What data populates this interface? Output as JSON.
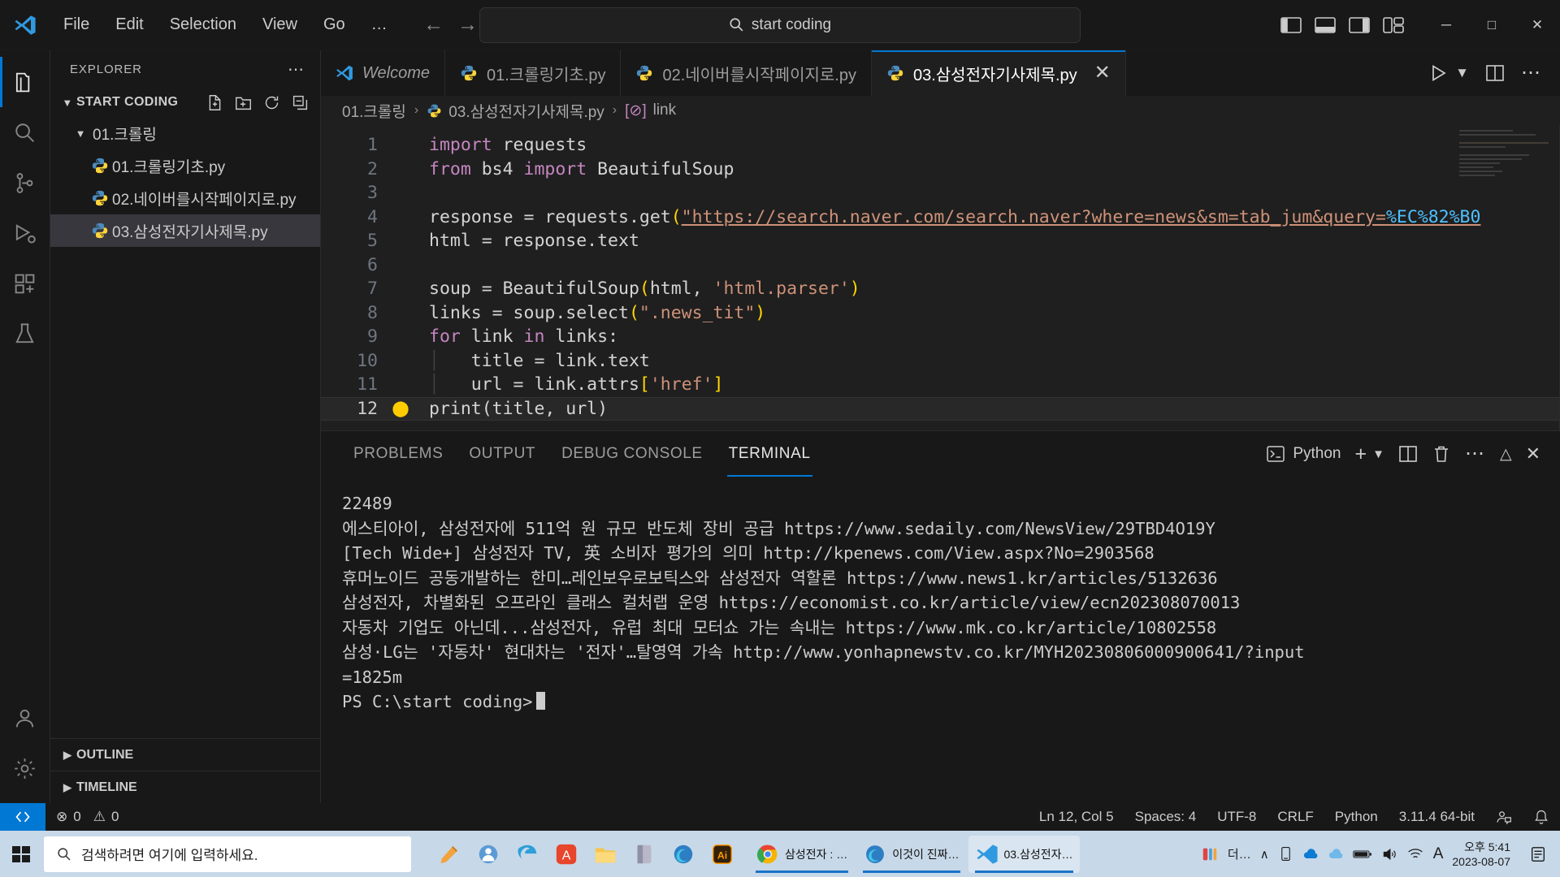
{
  "titlebar": {
    "menus": [
      "File",
      "Edit",
      "Selection",
      "View",
      "Go",
      "…"
    ],
    "back_icon": "←",
    "forward_icon": "→",
    "command_center_text": "start coding",
    "search_icon": "⌕",
    "minimize": "─",
    "maximize": "□",
    "close": "✕"
  },
  "activitybar": {
    "items": [
      {
        "name": "explorer",
        "icon": "files-icon"
      },
      {
        "name": "search",
        "icon": "search-icon"
      },
      {
        "name": "source-control",
        "icon": "source-control-icon"
      },
      {
        "name": "run-debug",
        "icon": "run-debug-icon"
      },
      {
        "name": "extensions",
        "icon": "extensions-icon"
      },
      {
        "name": "testing",
        "icon": "beaker-icon"
      }
    ],
    "bottom": [
      {
        "name": "accounts",
        "icon": "account-icon"
      },
      {
        "name": "settings",
        "icon": "gear-icon"
      }
    ]
  },
  "sidebar": {
    "title": "EXPLORER",
    "more_actions": "⋯",
    "root": "START CODING",
    "root_actions": [
      "new-file-icon",
      "new-folder-icon",
      "refresh-icon",
      "collapse-all-icon"
    ],
    "tree": [
      {
        "label": "01.크롤링",
        "type": "folder",
        "expanded": true,
        "selected": false
      },
      {
        "label": "01.크롤링기초.py",
        "type": "file",
        "selected": false
      },
      {
        "label": "02.네이버를시작페이지로.py",
        "type": "file",
        "selected": false
      },
      {
        "label": "03.삼성전자기사제목.py",
        "type": "file",
        "selected": true
      }
    ],
    "bottom_sections": [
      "OUTLINE",
      "TIMELINE"
    ]
  },
  "tabs": [
    {
      "label": "Welcome",
      "icon": "vscode-icon",
      "italic": true,
      "active": false,
      "closable": false
    },
    {
      "label": "01.크롤링기초.py",
      "icon": "python-icon",
      "italic": false,
      "active": false,
      "closable": false
    },
    {
      "label": "02.네이버를시작페이지로.py",
      "icon": "python-icon",
      "italic": false,
      "active": false,
      "closable": false
    },
    {
      "label": "03.삼성전자기사제목.py",
      "icon": "python-icon",
      "italic": false,
      "active": true,
      "closable": true
    }
  ],
  "tab_actions": {
    "run": "run-icon",
    "run_chevron": "⌄",
    "split": "split-editor-icon",
    "more": "⋯"
  },
  "breadcrumb": {
    "folder": "01.크롤링",
    "file": "03.삼성전자기사제목.py",
    "symbol": "link",
    "symbol_icon": "[⊘]",
    "separator": "›"
  },
  "code": {
    "lines": [
      {
        "n": "1",
        "tokens": [
          {
            "t": "import",
            "c": "k"
          },
          {
            "t": " requests",
            "c": "txt"
          }
        ]
      },
      {
        "n": "2",
        "tokens": [
          {
            "t": "from",
            "c": "k"
          },
          {
            "t": " bs4 ",
            "c": "txt"
          },
          {
            "t": "import",
            "c": "k"
          },
          {
            "t": " BeautifulSoup",
            "c": "txt"
          }
        ]
      },
      {
        "n": "3",
        "tokens": []
      },
      {
        "n": "4",
        "tokens": [
          {
            "t": "response = requests.get",
            "c": "txt"
          },
          {
            "t": "(",
            "c": "p"
          },
          {
            "t": "\"https://search.naver.com/search.naver?where=news&sm=tab_jum&query=",
            "c": "s-link"
          },
          {
            "t": "%EC%82%B0",
            "c": "esc-link"
          }
        ]
      },
      {
        "n": "5",
        "tokens": [
          {
            "t": "html = response.text",
            "c": "txt"
          }
        ]
      },
      {
        "n": "6",
        "tokens": []
      },
      {
        "n": "7",
        "tokens": [
          {
            "t": "soup = BeautifulSoup",
            "c": "txt"
          },
          {
            "t": "(",
            "c": "p"
          },
          {
            "t": "html, ",
            "c": "txt"
          },
          {
            "t": "'html.parser'",
            "c": "s"
          },
          {
            "t": ")",
            "c": "p"
          }
        ]
      },
      {
        "n": "8",
        "tokens": [
          {
            "t": "links = soup.select",
            "c": "txt"
          },
          {
            "t": "(",
            "c": "p"
          },
          {
            "t": "\".news_tit\"",
            "c": "s"
          },
          {
            "t": ")",
            "c": "p"
          }
        ]
      },
      {
        "n": "9",
        "tokens": [
          {
            "t": "for",
            "c": "k"
          },
          {
            "t": " link ",
            "c": "txt"
          },
          {
            "t": "in",
            "c": "k"
          },
          {
            "t": " links:",
            "c": "txt"
          }
        ]
      },
      {
        "n": "10",
        "tokens": [
          {
            "t": "    title = link.text",
            "c": "txt"
          }
        ]
      },
      {
        "n": "11",
        "tokens": [
          {
            "t": "    url = link.attrs",
            "c": "txt"
          },
          {
            "t": "[",
            "c": "p"
          },
          {
            "t": "'href'",
            "c": "s"
          },
          {
            "t": "]",
            "c": "p"
          }
        ]
      },
      {
        "n": "12",
        "tokens": [
          {
            "t": "    print(title, url)",
            "c": "txt"
          }
        ],
        "bulb": true,
        "current": true
      }
    ]
  },
  "panel": {
    "tabs": [
      "PROBLEMS",
      "OUTPUT",
      "DEBUG CONSOLE",
      "TERMINAL"
    ],
    "active_tab": "TERMINAL",
    "shell_label": "Python",
    "actions": {
      "new": "+",
      "chevron": "⌄",
      "split": "split-terminal-icon",
      "kill": "trash-icon",
      "more": "⋯",
      "maximize": "⌃",
      "close": "✕"
    },
    "terminal_lines": [
      "22489",
      "에스티아이, 삼성전자에 511억 원 규모 반도체 장비 공급 https://www.sedaily.com/NewsView/29TBD4O19Y",
      "[Tech Wide+] 삼성전자 TV, 英 소비자 평가의 의미 http://kpenews.com/View.aspx?No=2903568",
      "휴머노이드 공동개발하는 한미…레인보우로보틱스와 삼성전자 역할론 https://www.news1.kr/articles/5132636",
      "삼성전자, 차별화된 오프라인 클래스 컬처랩 운영 https://economist.co.kr/article/view/ecn202308070013",
      "자동차 기업도 아닌데...삼성전자, 유럽 최대 모터쇼 가는 속내는 https://www.mk.co.kr/article/10802558",
      "삼성·LG는 '자동차' 현대차는 '전자'…탈영역 가속 http://www.yonhapnewstv.co.kr/MYH20230806000900641/?input",
      "=1825m",
      "PS C:\\start coding>"
    ]
  },
  "statusbar": {
    "remote_icon": "remote-icon",
    "errors": "0",
    "warnings": "0",
    "error_icon": "⊗",
    "warning_icon": "⚠",
    "position": "Ln 12, Col 5",
    "indentation": "Spaces: 4",
    "encoding": "UTF-8",
    "eol": "CRLF",
    "language": "Python",
    "interpreter": "3.11.4 64-bit",
    "feedback_icon": "feedback-icon",
    "bell_icon": "bell-icon"
  },
  "taskbar": {
    "start_icon": "windows-icon",
    "search_placeholder": "검색하려면 여기에 입력하세요.",
    "search_icon": "⌕",
    "pinned": [
      "paint-icon",
      "teams-icon",
      "edge-legacy-icon",
      "adobe-icon",
      "explorer-icon",
      "onenote-icon",
      "edge-icon",
      "illustrator-icon"
    ],
    "apps": [
      {
        "label": "삼성전자 : …",
        "icon": "chrome-icon",
        "active": false
      },
      {
        "label": "이것이 진짜…",
        "icon": "edge-icon",
        "active": false
      },
      {
        "label": "03.삼성전자…",
        "icon": "vscode-icon",
        "active": true
      }
    ],
    "tray": {
      "ime_label": "더…",
      "chevron": "∧",
      "time": "오후 5:41",
      "date": "2023-08-07",
      "letter": "A"
    }
  }
}
